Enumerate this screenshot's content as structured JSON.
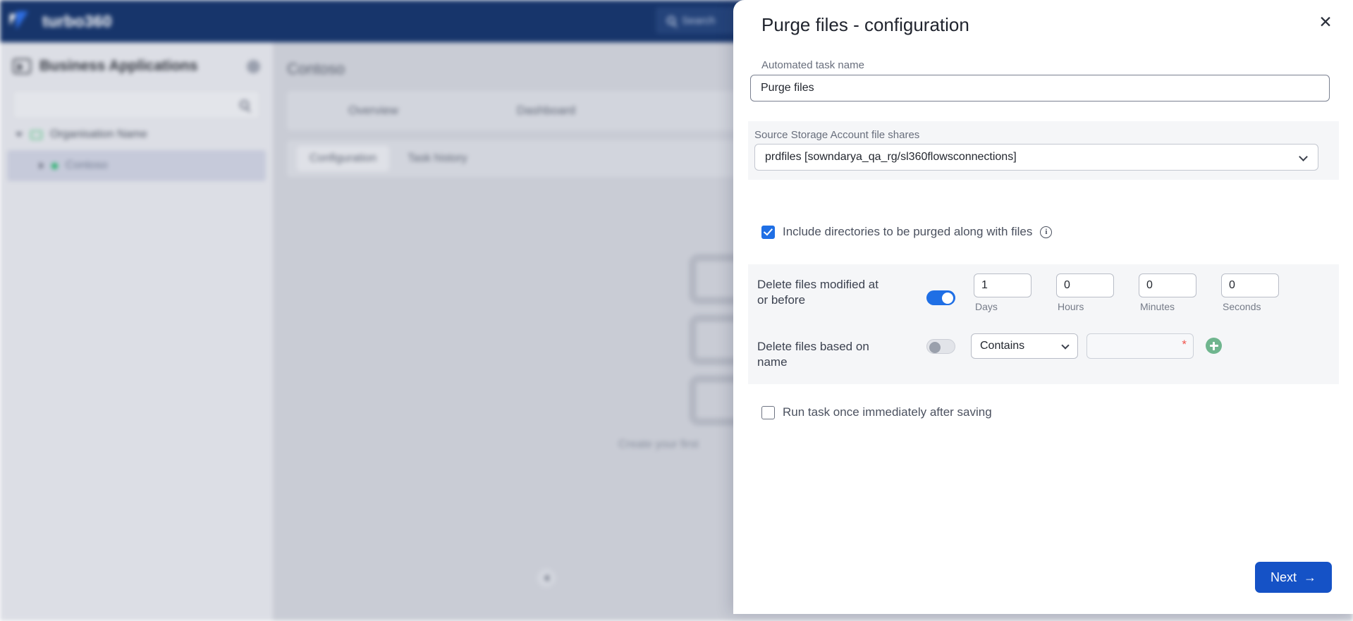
{
  "background": {
    "brand": "turbo360",
    "search_placeholder": "Search",
    "sidebar": {
      "title": "Business Applications",
      "search_value": "",
      "tree": [
        {
          "label": "Organisation Name"
        },
        {
          "label": "Contoso"
        }
      ]
    },
    "main": {
      "page_title": "Contoso",
      "tabs": [
        {
          "label": "Overview"
        },
        {
          "label": "Dashboard"
        }
      ],
      "subtabs": [
        {
          "label": "Configuration"
        },
        {
          "label": "Task history"
        }
      ],
      "empty_state_text": "Create your first"
    }
  },
  "panel": {
    "title": "Purge files - configuration",
    "close_label": "✕",
    "task_name": {
      "label": "Automated task name",
      "value": "Purge files"
    },
    "source": {
      "label": "Source Storage Account file shares",
      "selected": "prdfiles [sowndarya_qa_rg/sl360flowsconnections]"
    },
    "include_directories": {
      "label": "Include directories to be purged along with files",
      "checked": true,
      "info_glyph": "i"
    },
    "delete_modified": {
      "label": "Delete files modified at or before",
      "toggle_on": true,
      "fields": [
        {
          "value": "1",
          "caption": "Days"
        },
        {
          "value": "0",
          "caption": "Hours"
        },
        {
          "value": "0",
          "caption": "Minutes"
        },
        {
          "value": "0",
          "caption": "Seconds"
        }
      ]
    },
    "delete_by_name": {
      "label": "Delete files based on name",
      "toggle_on": false,
      "operator": "Contains",
      "value": "",
      "required_marker": "*"
    },
    "run_once": {
      "label": "Run task once immediately after saving",
      "checked": false
    },
    "next_button": {
      "label": "Next",
      "arrow": "→"
    },
    "colors": {
      "accent_blue": "#1f6fe5",
      "next_blue": "#1552c6",
      "required_red": "#f0554d",
      "add_green": "#6fb58e",
      "header_navy": "#17356b"
    }
  }
}
